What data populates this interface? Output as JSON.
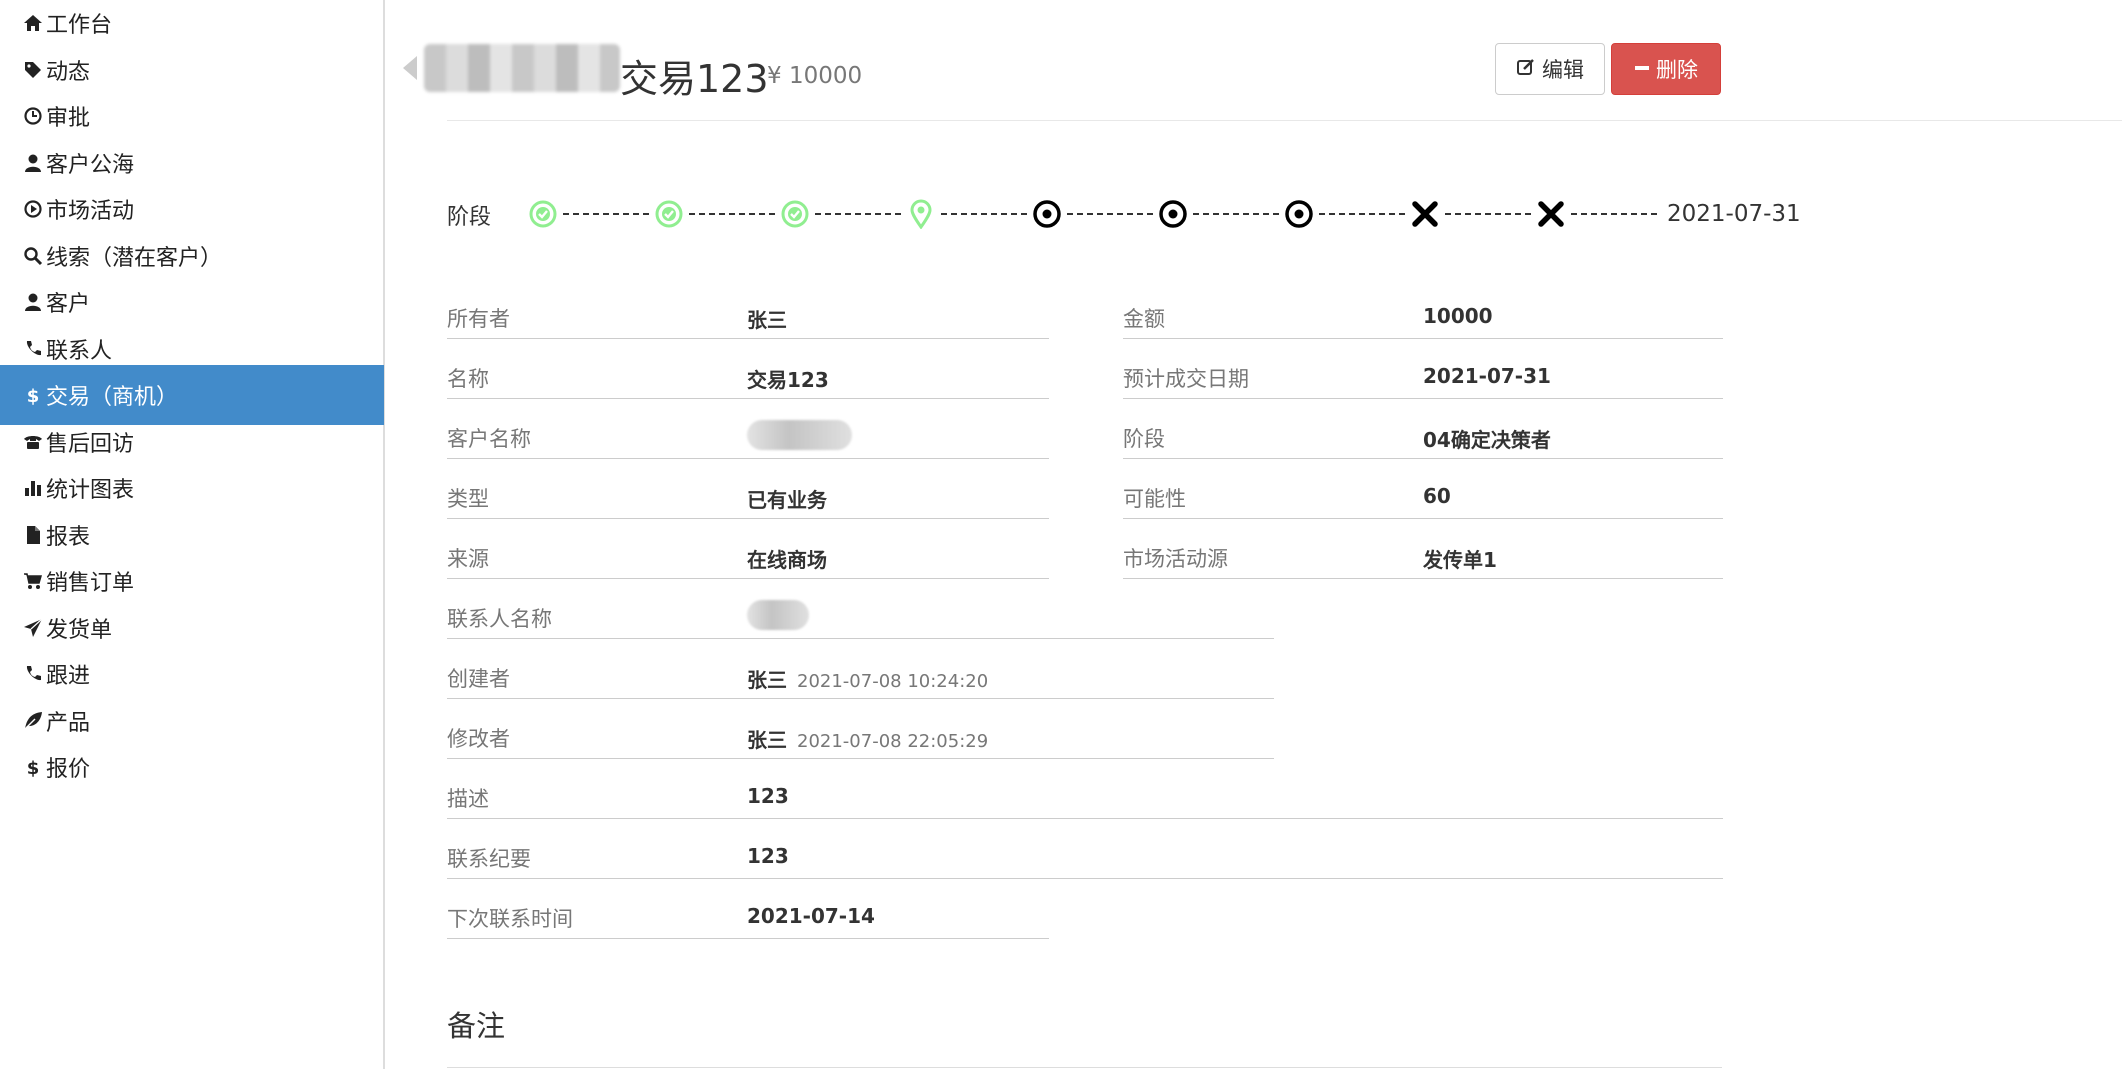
{
  "sidebar": {
    "items": [
      {
        "label": "工作台",
        "icon": "home-icon"
      },
      {
        "label": "动态",
        "icon": "tag-icon"
      },
      {
        "label": "审批",
        "icon": "clock-icon"
      },
      {
        "label": "客户公海",
        "icon": "user-icon"
      },
      {
        "label": "市场活动",
        "icon": "play-circle-icon"
      },
      {
        "label": "线索（潜在客户）",
        "icon": "search-icon"
      },
      {
        "label": "客户",
        "icon": "user-icon"
      },
      {
        "label": "联系人",
        "icon": "phone-icon"
      },
      {
        "label": "交易（商机）",
        "icon": "dollar-icon",
        "active": true
      },
      {
        "label": "售后回访",
        "icon": "telephone-icon"
      },
      {
        "label": "统计图表",
        "icon": "bar-chart-icon"
      },
      {
        "label": "报表",
        "icon": "file-icon"
      },
      {
        "label": "销售订单",
        "icon": "cart-icon"
      },
      {
        "label": "发货单",
        "icon": "send-icon"
      },
      {
        "label": "跟进",
        "icon": "phone-icon"
      },
      {
        "label": "产品",
        "icon": "leaf-icon"
      },
      {
        "label": "报价",
        "icon": "dollar-icon"
      }
    ],
    "accent_color": "#428bca"
  },
  "header": {
    "title": "交易123",
    "amount": "¥ 10000",
    "edit_label": "编辑",
    "delete_label": "删除",
    "delete_color": "#d9534f"
  },
  "stage": {
    "label": "阶段",
    "steps": [
      "done",
      "done",
      "done",
      "current",
      "pending",
      "pending",
      "pending",
      "lost",
      "lost"
    ],
    "date": "2021-07-31",
    "done_color": "#90ee90"
  },
  "fields_left": [
    {
      "label": "所有者",
      "value": "张三"
    },
    {
      "label": "名称",
      "value": "交易123"
    },
    {
      "label": "客户名称",
      "value": ""
    },
    {
      "label": "类型",
      "value": "已有业务"
    },
    {
      "label": "来源",
      "value": "在线商场"
    }
  ],
  "fields_right": [
    {
      "label": "金额",
      "value": "10000"
    },
    {
      "label": "预计成交日期",
      "value": "2021-07-31"
    },
    {
      "label": "阶段",
      "value": "04确定决策者"
    },
    {
      "label": "可能性",
      "value": "60"
    },
    {
      "label": "市场活动源",
      "value": "发传单1"
    }
  ],
  "contact": {
    "label": "联系人名称",
    "value": ""
  },
  "creator": {
    "label": "创建者",
    "value": "张三",
    "time": "2021-07-08 10:24:20"
  },
  "editor": {
    "label": "修改者",
    "value": "张三",
    "time": "2021-07-08 22:05:29"
  },
  "description": {
    "label": "描述",
    "value": "123"
  },
  "summary": {
    "label": "联系纪要",
    "value": "123"
  },
  "next_contact": {
    "label": "下次联系时间",
    "value": "2021-07-14"
  },
  "notes": {
    "title": "备注"
  }
}
